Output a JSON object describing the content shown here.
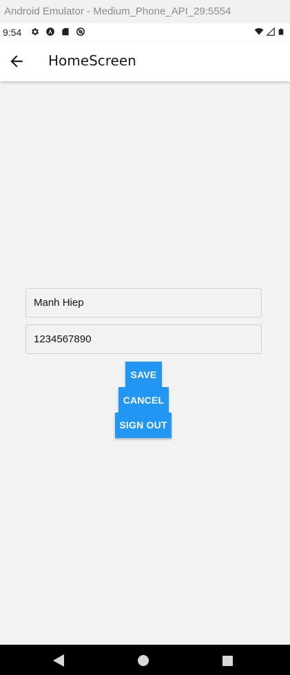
{
  "window": {
    "title": "Android Emulator - Medium_Phone_API_29:5554"
  },
  "status_bar": {
    "time": "9:54",
    "left_icons": [
      "settings-icon",
      "android-auto-icon",
      "sd-card-icon",
      "no-disturb-icon"
    ],
    "right_icons": [
      "wifi-icon",
      "signal-icon",
      "battery-icon"
    ]
  },
  "app_bar": {
    "title": "HomeScreen",
    "back_icon": "arrow-back-icon"
  },
  "form": {
    "name_value": "Manh Hiep",
    "phone_value": "1234567890"
  },
  "buttons": {
    "save_label": "SAVE",
    "cancel_label": "CANCEL",
    "signout_label": "SIGN OUT",
    "color": "#2196f3"
  },
  "nav_bar": {
    "icons": [
      "nav-back-icon",
      "nav-home-icon",
      "nav-recents-icon"
    ]
  }
}
